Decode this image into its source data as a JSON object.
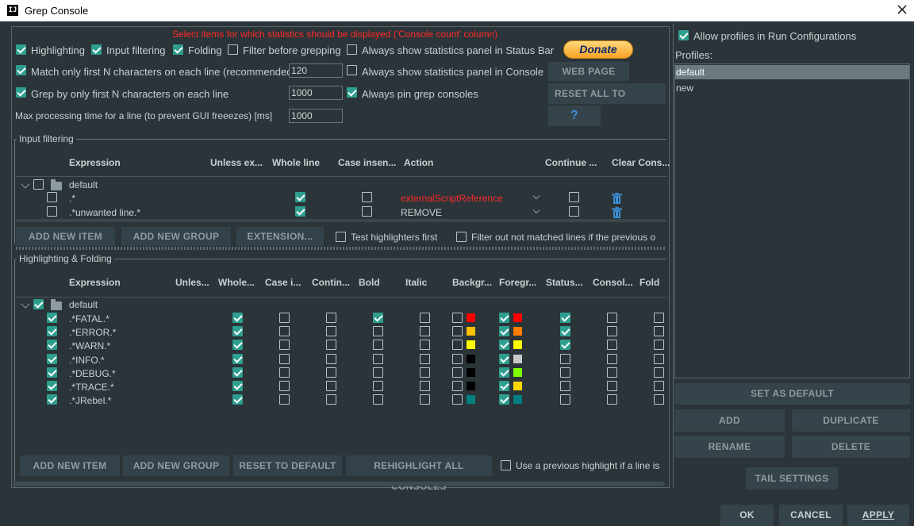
{
  "window": {
    "title": "Grep Console"
  },
  "top_notice": "Select items for which statistics should be displayed ('Console count' column)",
  "options": {
    "highlighting": "Highlighting",
    "input_filtering": "Input filtering",
    "folding": "Folding",
    "filter_before_grepping": "Filter before grepping",
    "always_status_bar": "Always show statistics panel in Status Bar",
    "match_first_n": "Match only first N characters on each line (recommended)",
    "match_first_n_value": "120",
    "always_console": "Always show statistics panel in Console",
    "grep_first_n": "Grep by only first N characters on each line",
    "grep_first_n_value": "1000",
    "always_pin": "Always pin grep consoles",
    "max_time": "Max processing time for a line (to prevent GUI freeezes) [ms]",
    "max_time_value": "1000"
  },
  "side_buttons": {
    "donate": "Donate",
    "web_page": "WEB PAGE",
    "reset_all": "RESET ALL TO DEFAULT",
    "help": "?"
  },
  "input_filtering": {
    "title": "Input filtering",
    "headers": [
      "Expression",
      "Unless ex...",
      "Whole line",
      "Case insen...",
      "Action",
      "Continue ...",
      "Clear Cons..."
    ],
    "group": "default",
    "rows": [
      {
        "expression": ".*",
        "action": "externalScriptReference"
      },
      {
        "expression": ".*unwanted line.*",
        "action": "REMOVE"
      }
    ],
    "buttons": {
      "add_item": "ADD NEW ITEM",
      "add_group": "ADD NEW GROUP",
      "extension": "EXTENSION...",
      "test_first": "Test highlighters first",
      "filter_out": "Filter out not matched lines if the previous o"
    }
  },
  "highlighting": {
    "title": "Highlighting & Folding",
    "headers": [
      "Expression",
      "Unles...",
      "Whole...",
      "Case i...",
      "Contin...",
      "Bold",
      "Italic",
      "Backgr...",
      "Foregr...",
      "Status...",
      "Consol...",
      "Fold"
    ],
    "group": "default",
    "rows": [
      {
        "expression": ".*FATAL.*",
        "bg": "#ff0000",
        "fg": "#ff0000",
        "bold": true,
        "status": true
      },
      {
        "expression": ".*ERROR.*",
        "bg": "#ffc000",
        "fg": "#ff8000",
        "bold": false,
        "status": true
      },
      {
        "expression": ".*WARN.*",
        "bg": "#ffff00",
        "fg": "#ffff00",
        "bold": false,
        "status": true
      },
      {
        "expression": ".*INFO.*",
        "bg": "#000000",
        "fg": "#c8c8c8",
        "bold": false,
        "status": false
      },
      {
        "expression": ".*DEBUG.*",
        "bg": "#000000",
        "fg": "#80ff00",
        "bold": false,
        "status": false
      },
      {
        "expression": ".*TRACE.*",
        "bg": "#000000",
        "fg": "#ffd700",
        "bold": false,
        "status": false
      },
      {
        "expression": ".*JRebel.*",
        "bg": "#008080",
        "fg": "#008080",
        "bold": false,
        "status": false
      }
    ],
    "buttons": {
      "add_item": "ADD NEW ITEM",
      "add_group": "ADD NEW GROUP",
      "reset": "RESET TO DEFAULT",
      "rehighlight": "REHIGHLIGHT ALL CONSOLES",
      "use_previous": "Use a previous highlight if a line is"
    }
  },
  "profiles": {
    "allow": "Allow profiles in Run Configurations",
    "label": "Profiles:",
    "items": [
      "default",
      "new"
    ],
    "set_default": "SET AS DEFAULT",
    "add": "ADD",
    "duplicate": "DUPLICATE",
    "rename": "RENAME",
    "delete": "DELETE",
    "tail": "TAIL SETTINGS"
  },
  "footer": {
    "ok": "OK",
    "cancel": "CANCEL",
    "apply": "APPLY"
  },
  "colors": {
    "accent": "#2e9e8f",
    "warning_text": "#ff2a2a",
    "donate": "#f7a325"
  }
}
